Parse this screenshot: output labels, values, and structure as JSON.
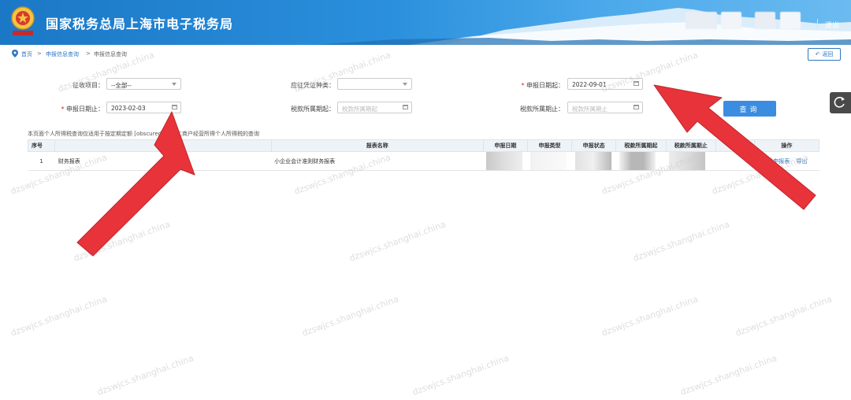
{
  "header": {
    "title": "国家税务总局上海市电子税务局",
    "logout": "退出"
  },
  "breadcrumb": {
    "home": "首页",
    "level1": "申报信息查询",
    "level2": "申报信息查询"
  },
  "back_label": "返回",
  "form": {
    "levy_item_label": "征收项目：",
    "levy_item_value": "--全部--",
    "voucher_type_label": "应征凭证种类：",
    "voucher_type_value": "",
    "declare_date_start_label": "申报日期起：",
    "declare_date_start_value": "2022-09-01",
    "declare_date_end_label": "申报日期止：",
    "declare_date_end_value": "2023-02-03",
    "tax_period_start_label": "税款所属期起：",
    "tax_period_start_placeholder": "税款所属期起",
    "tax_period_end_label": "税款所属期止：",
    "tax_period_end_placeholder": "税款所属期止",
    "query_button": "查询"
  },
  "note": "本页面个人所得税查询仅适用于按定期定额 [obscured] 个体工商户经营所得个人所得税的查询",
  "table": {
    "columns": [
      "序号",
      "报表名称",
      "申报日期",
      "申报类型",
      "申报状态",
      "税款所属期起",
      "税款所属期止",
      "税款",
      "操作"
    ],
    "rows": [
      {
        "index": "1",
        "category": "财务报表",
        "name": "小企业会计准则财务报表",
        "view": "查看申报表",
        "export": "导出"
      }
    ]
  },
  "watermark": "dzswjcs.shanghai.china",
  "colors": {
    "header": "#2a8fdc",
    "link": "#2f77c1",
    "primary_button": "#3a8de0",
    "required": "#e02020",
    "arrow": "#e8333a"
  }
}
